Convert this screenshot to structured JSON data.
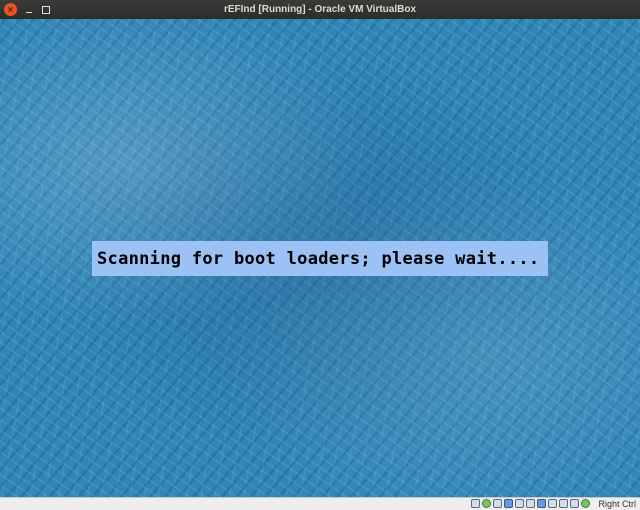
{
  "window": {
    "title": "rEFInd [Running] - Oracle VM VirtualBox",
    "close_glyph": "×",
    "minimize_icon": "minimize-icon",
    "maximize_icon": "maximize-icon"
  },
  "screen": {
    "message": "Scanning for boot loaders; please wait....",
    "message_bg": "#9bc1f5",
    "wallpaper_color": "#2f86b8"
  },
  "statusbar": {
    "icons": [
      "hard-disk-icon",
      "optical-drive-icon",
      "audio-icon",
      "network-icon",
      "usb-icon",
      "shared-folders-icon",
      "display-icon",
      "video-capture-icon",
      "virtualization-icon",
      "mouse-integration-icon",
      "keyboard-icon"
    ],
    "host_key": "Right Ctrl"
  }
}
